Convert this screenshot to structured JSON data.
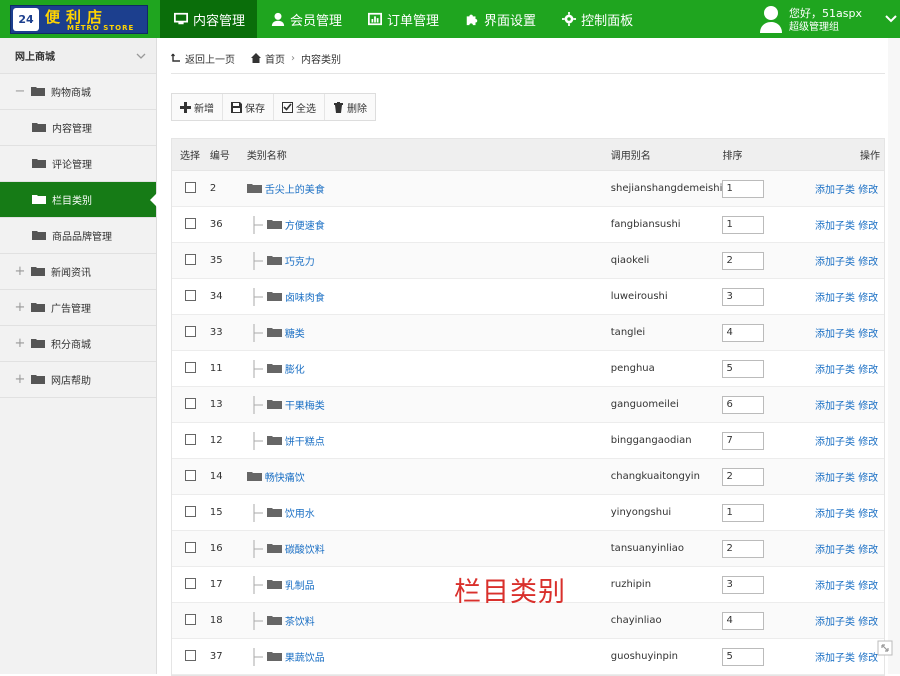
{
  "logo": {
    "badge": "24",
    "cn": "便利店",
    "en": "METRO STORE"
  },
  "nav": [
    {
      "label": "内容管理",
      "icon": "monitor-icon",
      "active": true
    },
    {
      "label": "会员管理",
      "icon": "user-icon"
    },
    {
      "label": "订单管理",
      "icon": "chart-icon"
    },
    {
      "label": "界面设置",
      "icon": "puzzle-icon"
    },
    {
      "label": "控制面板",
      "icon": "gear-icon"
    }
  ],
  "user": {
    "greeting": "您好，51aspx",
    "role": "超级管理组"
  },
  "sidebar": {
    "head": "网上商城",
    "items": [
      {
        "label": "购物商城",
        "type": "group",
        "sign": "−"
      },
      {
        "label": "内容管理",
        "type": "sub"
      },
      {
        "label": "评论管理",
        "type": "sub"
      },
      {
        "label": "栏目类别",
        "type": "sub",
        "active": true
      },
      {
        "label": "商品品牌管理",
        "type": "sub"
      },
      {
        "label": "新闻资讯",
        "type": "group",
        "sign": "+"
      },
      {
        "label": "广告管理",
        "type": "group",
        "sign": "+"
      },
      {
        "label": "积分商城",
        "type": "group",
        "sign": "+"
      },
      {
        "label": "网店帮助",
        "type": "group",
        "sign": "+"
      }
    ]
  },
  "breadcrumb": {
    "back": "返回上一页",
    "home": "首页",
    "current": "内容类别"
  },
  "toolbar": {
    "add": "新增",
    "save": "保存",
    "select_all": "全选",
    "delete": "删除"
  },
  "table": {
    "headers": {
      "select": "选择",
      "id": "编号",
      "name": "类别名称",
      "alias": "调用别名",
      "order": "排序",
      "ops": "操作"
    },
    "op_add": "添加子类",
    "op_edit": "修改",
    "rows": [
      {
        "id": "2",
        "name": "舌尖上的美食",
        "alias": "shejianshangdemeishi",
        "order": "1",
        "level": 0
      },
      {
        "id": "36",
        "name": "方便速食",
        "alias": "fangbiansushi",
        "order": "1",
        "level": 1
      },
      {
        "id": "35",
        "name": "巧克力",
        "alias": "qiaokeli",
        "order": "2",
        "level": 1
      },
      {
        "id": "34",
        "name": "卤味肉食",
        "alias": "luweiroushi",
        "order": "3",
        "level": 1
      },
      {
        "id": "33",
        "name": "糖类",
        "alias": "tanglei",
        "order": "4",
        "level": 1
      },
      {
        "id": "11",
        "name": "膨化",
        "alias": "penghua",
        "order": "5",
        "level": 1
      },
      {
        "id": "13",
        "name": "干果梅类",
        "alias": "ganguomeilei",
        "order": "6",
        "level": 1
      },
      {
        "id": "12",
        "name": "饼干糕点",
        "alias": "binggangaodian",
        "order": "7",
        "level": 1
      },
      {
        "id": "14",
        "name": "畅快痛饮",
        "alias": "changkuaitongyin",
        "order": "2",
        "level": 0
      },
      {
        "id": "15",
        "name": "饮用水",
        "alias": "yinyongshui",
        "order": "1",
        "level": 1
      },
      {
        "id": "16",
        "name": "碳酸饮料",
        "alias": "tansuanyinliao",
        "order": "2",
        "level": 1
      },
      {
        "id": "17",
        "name": "乳制品",
        "alias": "ruzhipin",
        "order": "3",
        "level": 1
      },
      {
        "id": "18",
        "name": "茶饮料",
        "alias": "chayinliao",
        "order": "4",
        "level": 1
      },
      {
        "id": "37",
        "name": "果蔬饮品",
        "alias": "guoshuyinpin",
        "order": "5",
        "level": 1
      }
    ]
  },
  "watermark": "栏目类别",
  "colors": {
    "brand_green": "#1fa51f",
    "active_green": "#167b16",
    "link_blue": "#1a6fc4",
    "watermark_red": "#d9302c"
  }
}
